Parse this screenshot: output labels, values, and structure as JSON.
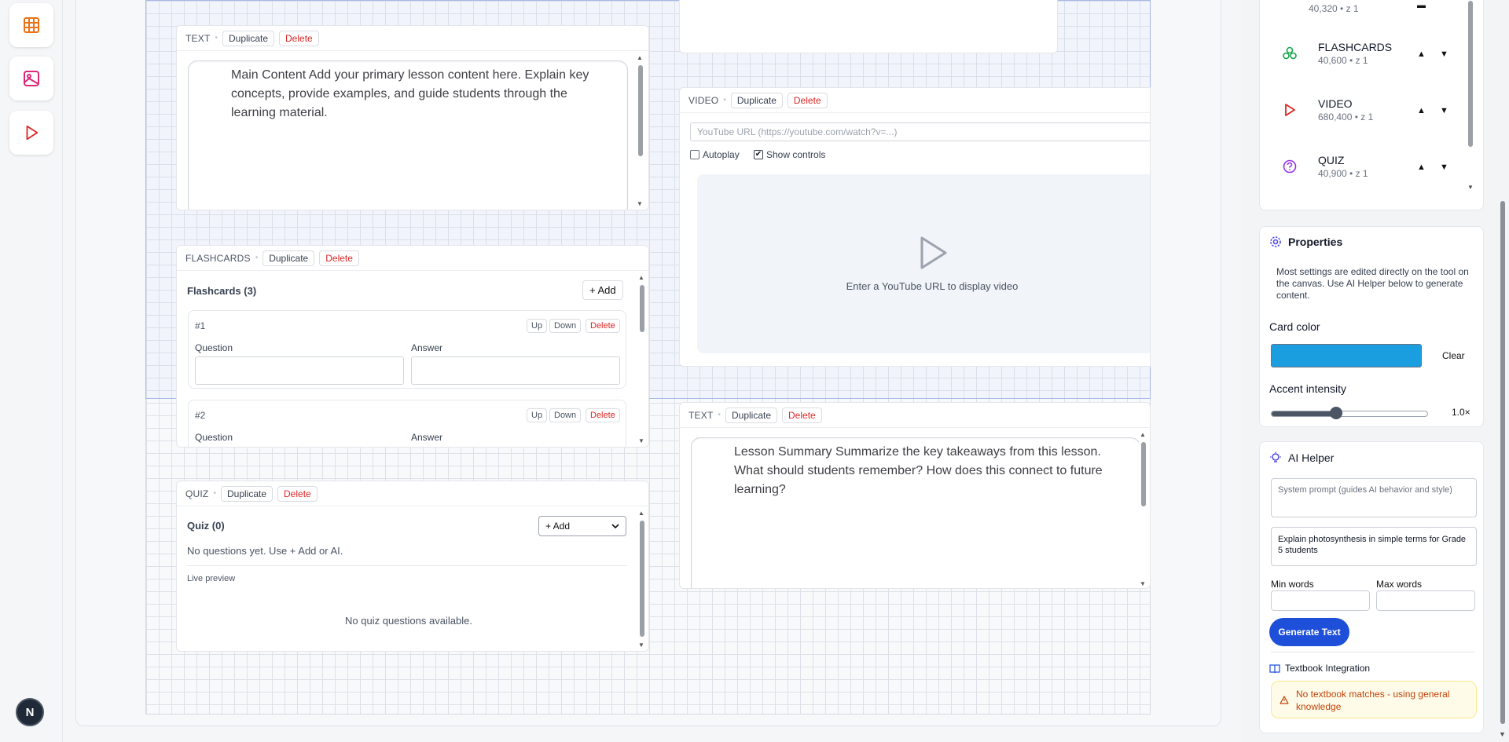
{
  "rail": {
    "icons": [
      "grid-icon",
      "image-icon",
      "play-icon"
    ],
    "badge": "N"
  },
  "cards": {
    "text1": {
      "kind": "TEXT",
      "duplicate": "Duplicate",
      "delete": "Delete",
      "content": "Main Content Add your primary lesson content here. Explain key concepts, provide examples, and guide students through the learning material."
    },
    "video": {
      "kind": "VIDEO",
      "duplicate": "Duplicate",
      "delete": "Delete",
      "url_placeholder": "YouTube URL (https://youtube.com/watch?v=...)",
      "autoplay": "Autoplay",
      "autoplay_checked": false,
      "show_controls": "Show controls",
      "show_controls_checked": true,
      "placeholder_msg": "Enter a YouTube URL to display video"
    },
    "flashcards": {
      "kind": "FLASHCARDS",
      "duplicate": "Duplicate",
      "delete": "Delete",
      "title": "Flashcards (3)",
      "add": "+ Add",
      "items": [
        {
          "num": "#1",
          "up": "Up",
          "down": "Down",
          "delete": "Delete",
          "question": "Question",
          "answer": "Answer"
        },
        {
          "num": "#2",
          "up": "Up",
          "down": "Down",
          "delete": "Delete",
          "question": "Question",
          "answer": "Answer"
        }
      ]
    },
    "text2": {
      "kind": "TEXT",
      "duplicate": "Duplicate",
      "delete": "Delete",
      "content": "Lesson Summary Summarize the key takeaways from this lesson. What should students remember? How does this connect to future learning?"
    },
    "quiz": {
      "kind": "QUIZ",
      "duplicate": "Duplicate",
      "delete": "Delete",
      "title": "Quiz (0)",
      "add_select": "+ Add",
      "empty": "No questions yet. Use + Add or AI.",
      "live_preview": "Live preview",
      "no_questions": "No quiz questions available."
    }
  },
  "layers": [
    {
      "name": "",
      "meta": "40,320 • z 1",
      "icon": "text-icon"
    },
    {
      "name": "FLASHCARDS",
      "meta": "40,600 • z 1",
      "icon": "flashcards-icon",
      "color": "#16a34a"
    },
    {
      "name": "VIDEO",
      "meta": "680,400 • z 1",
      "icon": "play-icon",
      "color": "#dc2626"
    },
    {
      "name": "QUIZ",
      "meta": "40,900 • z 1",
      "icon": "question-icon",
      "color": "#9333ea"
    }
  ],
  "properties": {
    "title": "Properties",
    "desc": "Most settings are edited directly on the tool on the canvas. Use AI Helper below to generate content.",
    "card_color_label": "Card color",
    "card_color": "#1a9ee0",
    "clear": "Clear",
    "accent_label": "Accent intensity",
    "accent_value": "1.0×",
    "accent_level": 0.4
  },
  "ai": {
    "title": "AI Helper",
    "system_placeholder": "System prompt (guides AI behavior and style)",
    "prompt": "Explain photosynthesis in simple terms for Grade 5 students",
    "min_words": "Min words",
    "max_words": "Max words",
    "generate": "Generate Text",
    "textbook": "Textbook Integration",
    "warning": "No textbook matches - using general knowledge"
  },
  "colors": {
    "accent": "#1e4fd8",
    "danger": "#dc2626",
    "warning_bg": "#fefce8"
  }
}
